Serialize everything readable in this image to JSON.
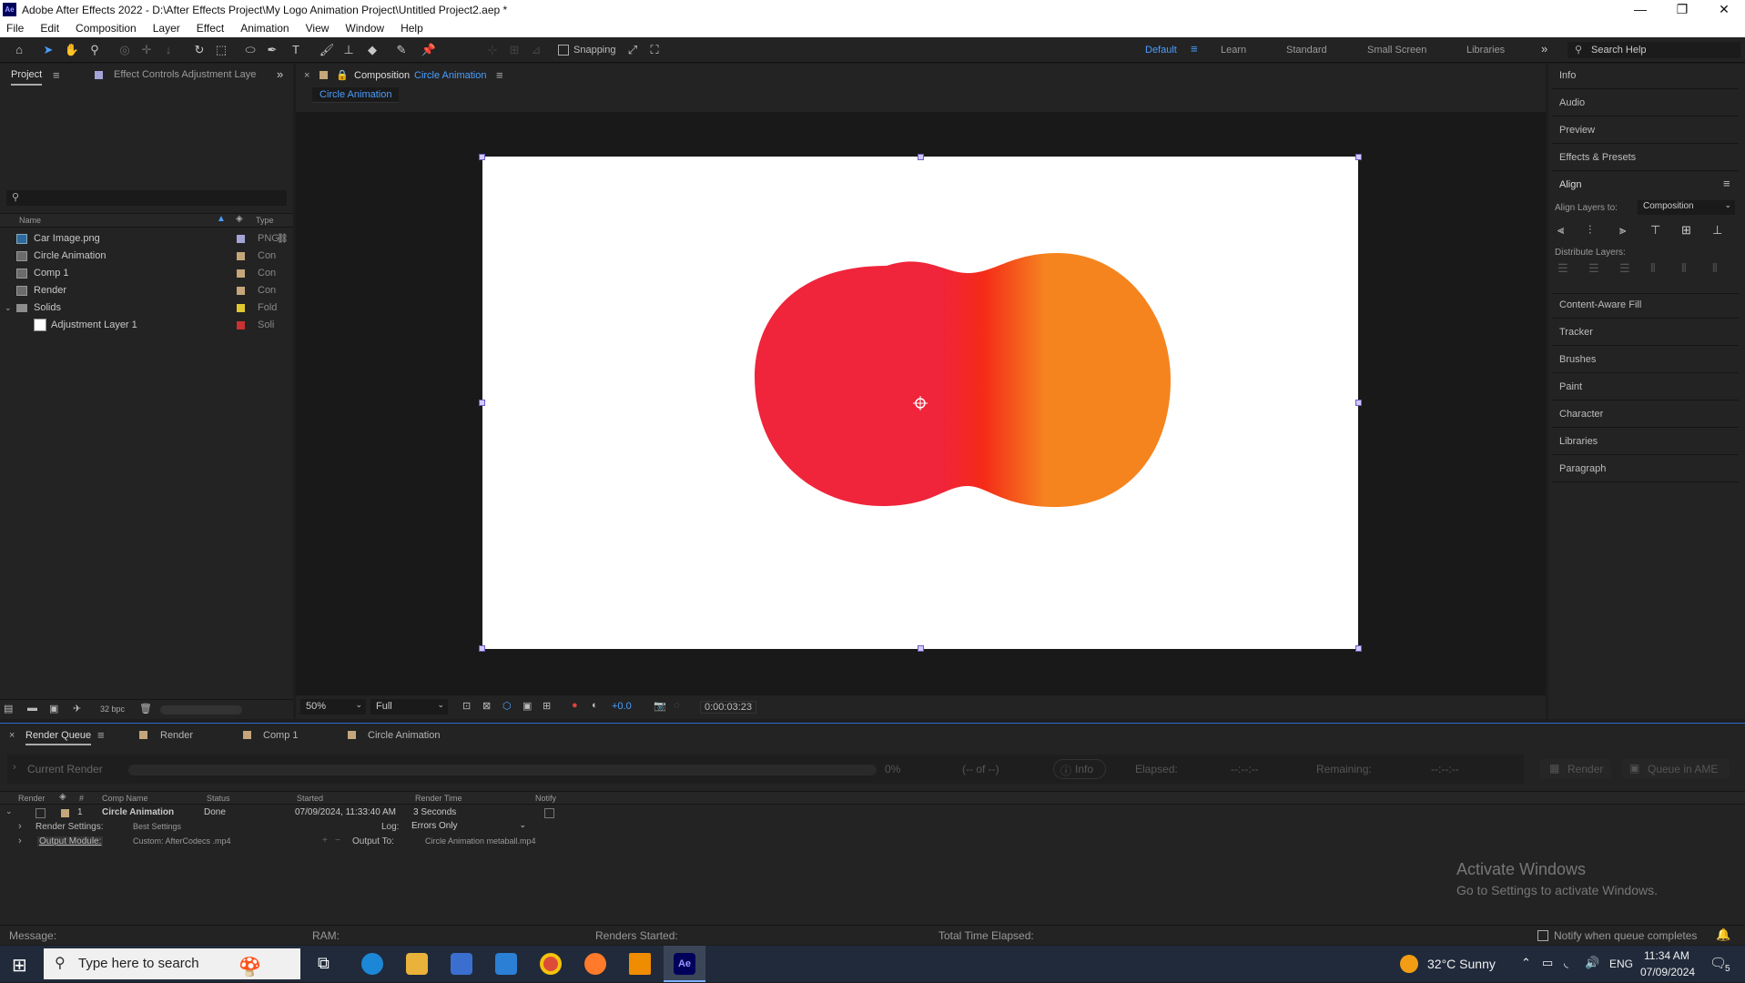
{
  "app": {
    "title": "Adobe After Effects 2022 - D:\\After Effects Project\\My Logo Animation Project\\Untitled Project2.aep *",
    "icon": "Ae",
    "window_controls": [
      "—",
      "❐",
      "✕"
    ]
  },
  "menu": [
    "File",
    "Edit",
    "Composition",
    "Layer",
    "Effect",
    "Animation",
    "View",
    "Window",
    "Help"
  ],
  "toolbar": {
    "snapping_label": "Snapping",
    "workspaces": [
      "Default",
      "Learn",
      "Standard",
      "Small Screen",
      "Libraries"
    ],
    "active_workspace": "Default",
    "search_placeholder": "Search Help"
  },
  "project_panel": {
    "tab_project": "Project",
    "tab_effect_controls": "Effect Controls Adjustment Laye",
    "col_name": "Name",
    "col_type": "Type",
    "items": [
      {
        "name": "Car Image.png",
        "type": "PNG",
        "label_color": "#a4a4d8"
      },
      {
        "name": "Circle Animation",
        "type": "Con",
        "label_color": "#c4a67a"
      },
      {
        "name": "Comp 1",
        "type": "Con",
        "label_color": "#c4a67a"
      },
      {
        "name": "Render",
        "type": "Con",
        "label_color": "#c4a67a"
      },
      {
        "name": "Solids",
        "type": "Fold",
        "label_color": "#e0c830"
      },
      {
        "name": "Adjustment Layer 1",
        "type": "Soli",
        "label_color": "#c83232"
      }
    ],
    "bpc": "32 bpc"
  },
  "composition_panel": {
    "tab_prefix": "Composition",
    "comp_name": "Circle Animation",
    "breadcrumb": "Circle Animation",
    "zoom": "50%",
    "resolution": "Full",
    "exposure": "+0.0",
    "timecode": "0:00:03:23",
    "colors": {
      "red": "#f0243a",
      "orange": "#f5841f"
    }
  },
  "right_panels": {
    "items_top": [
      "Info",
      "Audio",
      "Preview",
      "Effects & Presets"
    ],
    "align_title": "Align",
    "align_layers_to_label": "Align Layers to:",
    "align_layers_to_value": "Composition",
    "distribute_label": "Distribute Layers:",
    "items_bottom": [
      "Content-Aware Fill",
      "Tracker",
      "Brushes",
      "Paint",
      "Character",
      "Libraries",
      "Paragraph"
    ]
  },
  "render_queue": {
    "tabs": [
      "Render Queue",
      "Render",
      "Comp 1",
      "Circle Animation"
    ],
    "current_render_label": "Current Render",
    "progress": "0%",
    "of_text": "(-- of --)",
    "info_button": "Info",
    "elapsed_label": "Elapsed:",
    "elapsed_value": "--:--:--",
    "remaining_label": "Remaining:",
    "remaining_value": "--:--:--",
    "render_button": "Render",
    "queue_ame_button": "Queue in AME",
    "columns": [
      "Render",
      "#",
      "Comp Name",
      "Status",
      "Started",
      "Render Time",
      "Notify"
    ],
    "row": {
      "num": "1",
      "comp": "Circle Animation",
      "status": "Done",
      "started": "07/09/2024, 11:33:40 AM",
      "render_time": "3 Seconds"
    },
    "render_settings_label": "Render Settings:",
    "render_settings_value": "Best Settings",
    "log_label": "Log:",
    "log_value": "Errors Only",
    "output_module_label": "Output Module:",
    "output_module_value": "Custom: AfterCodecs .mp4",
    "output_to_label": "Output To:",
    "output_to_value": "Circle Animation metaball.mp4",
    "footer": {
      "message": "Message:",
      "ram": "RAM:",
      "renders_started": "Renders Started:",
      "total_time": "Total Time Elapsed:",
      "notify": "Notify when queue completes"
    }
  },
  "watermark": {
    "line1": "Activate Windows",
    "line2": "Go to Settings to activate Windows."
  },
  "taskbar": {
    "search_placeholder": "Type here to search",
    "weather": "32°C  Sunny",
    "lang": "ENG",
    "time": "11:34 AM",
    "date": "07/09/2024",
    "notification_count": "5"
  }
}
